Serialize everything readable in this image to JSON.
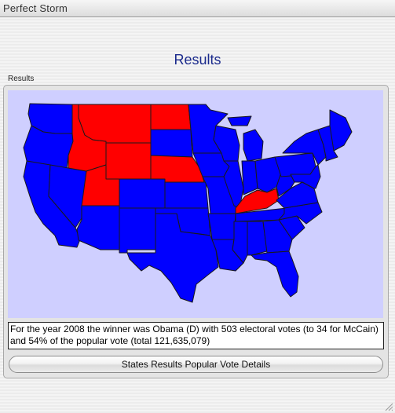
{
  "window": {
    "title": "Perfect Storm"
  },
  "page": {
    "heading": "Results"
  },
  "panel": {
    "label": "Results"
  },
  "colors": {
    "democrat": "#0000ff",
    "republican": "#ff0000",
    "map_background": "#cfcfff",
    "heading": "#1a2a8c"
  },
  "map": {
    "states": [
      {
        "name": "Washington",
        "party": "D"
      },
      {
        "name": "Oregon",
        "party": "D"
      },
      {
        "name": "California",
        "party": "D"
      },
      {
        "name": "Nevada",
        "party": "D"
      },
      {
        "name": "Idaho",
        "party": "R"
      },
      {
        "name": "Montana",
        "party": "R"
      },
      {
        "name": "Wyoming",
        "party": "R"
      },
      {
        "name": "Utah",
        "party": "R"
      },
      {
        "name": "Arizona",
        "party": "D"
      },
      {
        "name": "Colorado",
        "party": "D"
      },
      {
        "name": "New Mexico",
        "party": "D"
      },
      {
        "name": "North Dakota",
        "party": "R"
      },
      {
        "name": "South Dakota",
        "party": "D"
      },
      {
        "name": "Nebraska",
        "party": "R"
      },
      {
        "name": "Kansas",
        "party": "D"
      },
      {
        "name": "Oklahoma",
        "party": "D"
      },
      {
        "name": "Texas",
        "party": "D"
      },
      {
        "name": "Minnesota",
        "party": "D"
      },
      {
        "name": "Iowa",
        "party": "D"
      },
      {
        "name": "Missouri",
        "party": "D"
      },
      {
        "name": "Arkansas",
        "party": "D"
      },
      {
        "name": "Louisiana",
        "party": "D"
      },
      {
        "name": "Wisconsin",
        "party": "D"
      },
      {
        "name": "Illinois",
        "party": "D"
      },
      {
        "name": "Michigan",
        "party": "D"
      },
      {
        "name": "Indiana",
        "party": "D"
      },
      {
        "name": "Ohio",
        "party": "D"
      },
      {
        "name": "Kentucky",
        "party": "R"
      },
      {
        "name": "Tennessee",
        "party": "D"
      },
      {
        "name": "Mississippi",
        "party": "D"
      },
      {
        "name": "Alabama",
        "party": "D"
      },
      {
        "name": "Georgia",
        "party": "D"
      },
      {
        "name": "Florida",
        "party": "D"
      },
      {
        "name": "South Carolina",
        "party": "D"
      },
      {
        "name": "North Carolina",
        "party": "D"
      },
      {
        "name": "Virginia",
        "party": "D"
      },
      {
        "name": "West Virginia",
        "party": "D"
      },
      {
        "name": "Pennsylvania",
        "party": "D"
      },
      {
        "name": "New York",
        "party": "D"
      },
      {
        "name": "Maine",
        "party": "D"
      }
    ]
  },
  "result": {
    "text": "For the year 2008 the winner was Obama (D) with 503 electoral votes (to 34 for McCain)  and 54% of the popular vote (total 121,635,079)"
  },
  "buttons": {
    "details_label": "States Results Popular Vote Details"
  }
}
